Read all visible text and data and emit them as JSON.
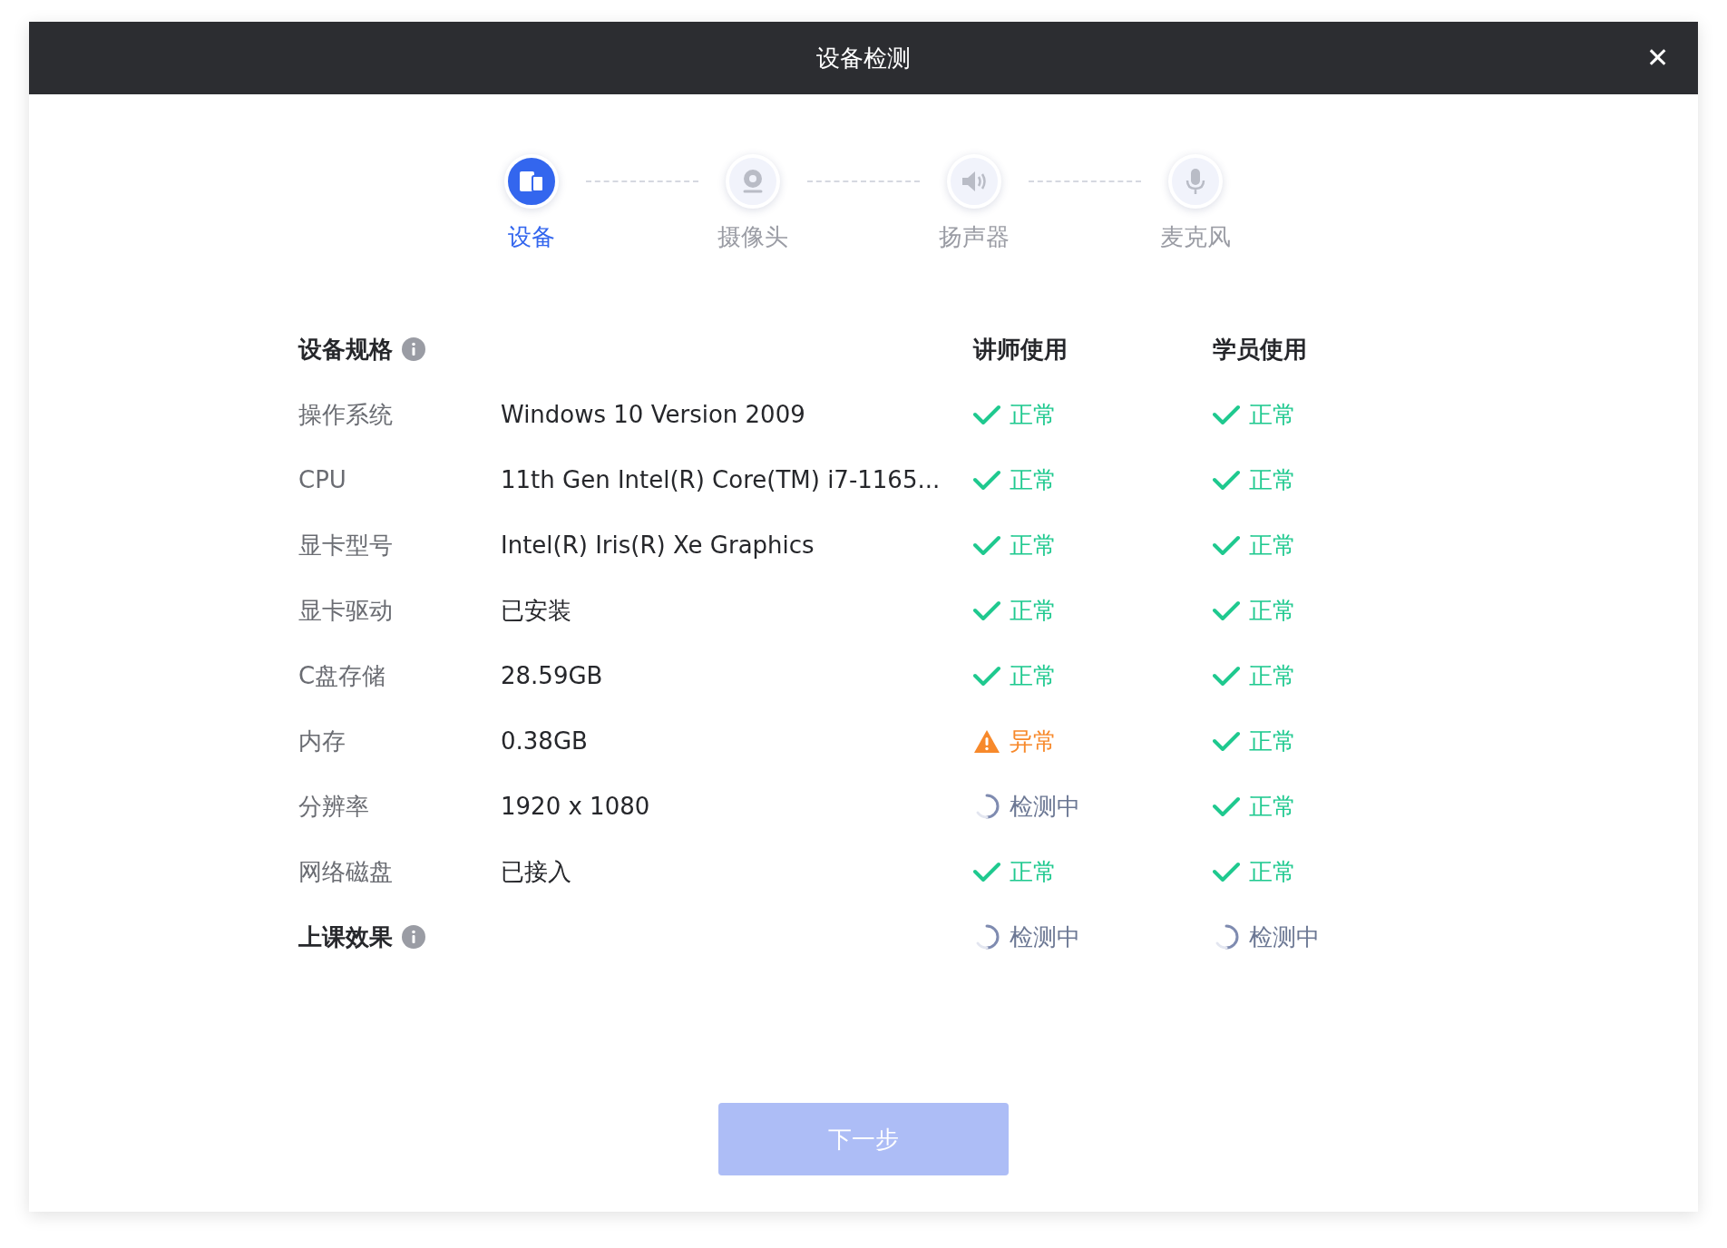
{
  "window": {
    "title": "设备检测",
    "close": "✕"
  },
  "steps": [
    {
      "label": "设备",
      "selected": true,
      "kind": "device"
    },
    {
      "label": "摄像头",
      "selected": false,
      "kind": "camera"
    },
    {
      "label": "扬声器",
      "selected": false,
      "kind": "speaker"
    },
    {
      "label": "麦克风",
      "selected": false,
      "kind": "mic"
    }
  ],
  "spec_header": {
    "title": "设备规格",
    "columns": [
      "讲师使用",
      "学员使用"
    ]
  },
  "rows": [
    {
      "name": "操作系统",
      "value": "Windows 10 Version 2009",
      "teacher": {
        "kind": "ok",
        "text": "正常"
      },
      "student": {
        "kind": "ok",
        "text": "正常"
      }
    },
    {
      "name": "CPU",
      "value": "11th Gen Intel(R) Core(TM) i7-1165...",
      "teacher": {
        "kind": "ok",
        "text": "正常"
      },
      "student": {
        "kind": "ok",
        "text": "正常"
      }
    },
    {
      "name": "显卡型号",
      "value": "Intel(R) Iris(R) Xe Graphics",
      "teacher": {
        "kind": "ok",
        "text": "正常"
      },
      "student": {
        "kind": "ok",
        "text": "正常"
      }
    },
    {
      "name": "显卡驱动",
      "value": "已安装",
      "teacher": {
        "kind": "ok",
        "text": "正常"
      },
      "student": {
        "kind": "ok",
        "text": "正常"
      }
    },
    {
      "name": "C盘存储",
      "value": "28.59GB",
      "teacher": {
        "kind": "ok",
        "text": "正常"
      },
      "student": {
        "kind": "ok",
        "text": "正常"
      }
    },
    {
      "name": "内存",
      "value": "0.38GB",
      "teacher": {
        "kind": "error",
        "text": "异常"
      },
      "student": {
        "kind": "ok",
        "text": "正常"
      }
    },
    {
      "name": "分辨率",
      "value": "1920 x 1080",
      "teacher": {
        "kind": "checking",
        "text": "检测中"
      },
      "student": {
        "kind": "ok",
        "text": "正常"
      }
    },
    {
      "name": "网络磁盘",
      "value": "已接入",
      "teacher": {
        "kind": "ok",
        "text": "正常"
      },
      "student": {
        "kind": "ok",
        "text": "正常"
      }
    }
  ],
  "effect": {
    "title": "上课效果",
    "teacher": {
      "kind": "checking",
      "text": "检测中"
    },
    "student": {
      "kind": "checking",
      "text": "检测中"
    }
  },
  "next_button": {
    "label": "下一步",
    "disabled": true
  }
}
